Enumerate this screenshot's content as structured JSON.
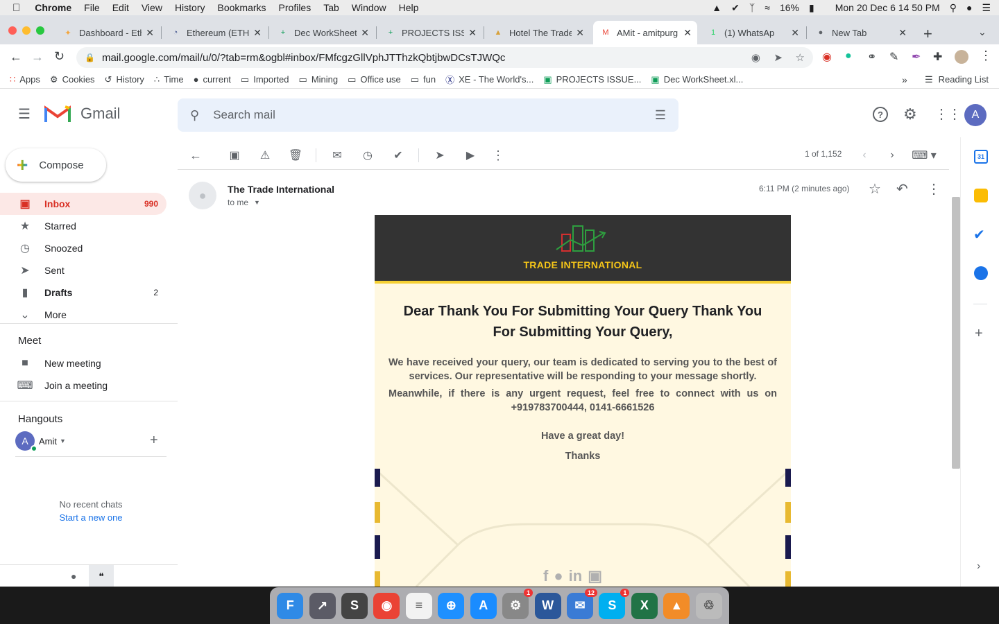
{
  "menubar": {
    "app": "Chrome",
    "items": [
      "File",
      "Edit",
      "View",
      "History",
      "Bookmarks",
      "Profiles",
      "Tab",
      "Window",
      "Help"
    ],
    "battery": "16%",
    "datetime": "Mon 20 Dec  6 14 50 PM"
  },
  "tabs": [
    {
      "title": "Dashboard - Eth",
      "fav": "✦",
      "favColor": "#f4a53a"
    },
    {
      "title": "Ethereum (ETH)",
      "fav": "◔",
      "favColor": "#3b4e8a"
    },
    {
      "title": "Dec WorkSheet",
      "fav": "+",
      "favColor": "#0f9d58"
    },
    {
      "title": "PROJECTS ISSU",
      "fav": "+",
      "favColor": "#0f9d58"
    },
    {
      "title": "Hotel The Trade",
      "fav": "▲",
      "favColor": "#d7a13b"
    },
    {
      "title": "AMit - amitpurg",
      "fav": "M",
      "favColor": "#ea4335"
    },
    {
      "title": "(1) WhatsAp",
      "fav": "1",
      "favColor": "#25d366"
    },
    {
      "title": "New Tab",
      "fav": "●",
      "favColor": "#5f6368"
    }
  ],
  "url": "mail.google.com/mail/u/0/?tab=rm&ogbl#inbox/FMfcgzGllVphJTThzkQbtjbwDCsTJWQc",
  "bookmarks": [
    {
      "label": "Apps",
      "icon": "grid-icon"
    },
    {
      "label": "Cookies",
      "icon": "gear-icon"
    },
    {
      "label": "History",
      "icon": "history-icon"
    },
    {
      "label": "Time",
      "icon": "dots-icon"
    },
    {
      "label": "current",
      "icon": "globe-icon"
    },
    {
      "label": "Imported",
      "icon": "folder-icon"
    },
    {
      "label": "Mining",
      "icon": "folder-icon"
    },
    {
      "label": "Office use",
      "icon": "folder-icon"
    },
    {
      "label": "fun",
      "icon": "folder-icon"
    },
    {
      "label": "XE - The World's...",
      "icon": "xe-icon"
    },
    {
      "label": "PROJECTS ISSUE...",
      "icon": "sheets-icon"
    },
    {
      "label": "Dec WorkSheet.xl...",
      "icon": "sheets-icon"
    }
  ],
  "reading_list": "Reading List",
  "gmail": {
    "brand": "Gmail",
    "search_placeholder": "Search mail",
    "avatar": "A",
    "compose": "Compose",
    "nav": [
      {
        "label": "Inbox",
        "count": "990",
        "icon": "inbox-icon",
        "active": true
      },
      {
        "label": "Starred",
        "count": "",
        "icon": "star-icon"
      },
      {
        "label": "Snoozed",
        "count": "",
        "icon": "clock-icon"
      },
      {
        "label": "Sent",
        "count": "",
        "icon": "send-icon"
      },
      {
        "label": "Drafts",
        "count": "2",
        "icon": "draft-icon"
      },
      {
        "label": "More",
        "count": "",
        "icon": "chevron-down-icon"
      }
    ],
    "meet_heading": "Meet",
    "meet": [
      {
        "label": "New meeting",
        "icon": "video-icon"
      },
      {
        "label": "Join a meeting",
        "icon": "keyboard-icon"
      }
    ],
    "hangouts_heading": "Hangouts",
    "hangouts_user": "Amit",
    "hangouts_avatar": "A",
    "no_chats": "No recent chats",
    "start_new": "Start a new one",
    "pager": "1 of 1,152"
  },
  "email": {
    "sender": "The Trade International",
    "to": "to me",
    "time": "6:11 PM (2 minutes ago)",
    "logo_text": "TRADE INTERNATIONAL",
    "heading": "Dear Thank You For Submitting Your Query Thank You For Submitting Your Query,",
    "para1": "We have received your query, our team is dedicated to serving you to the best of services. Our representative will be responding to your message shortly.",
    "para2": "Meanwhile, if there is any urgent request, feel free to connect with us on +919783700444, 0141-6661526",
    "greeting": "Have a great day!",
    "thanks": "Thanks"
  },
  "dock": [
    {
      "name": "finder",
      "label": "F",
      "color": "#2f8ae6",
      "badge": ""
    },
    {
      "name": "launchpad",
      "label": "↗",
      "color": "#5b5b66",
      "badge": ""
    },
    {
      "name": "sublime",
      "label": "S",
      "color": "#444",
      "badge": ""
    },
    {
      "name": "chrome",
      "label": "◉",
      "color": "#ea4335",
      "badge": ""
    },
    {
      "name": "notes",
      "label": "≡",
      "color": "#f2f2f2",
      "badge": ""
    },
    {
      "name": "safari",
      "label": "⊕",
      "color": "#1e90ff",
      "badge": ""
    },
    {
      "name": "appstore",
      "label": "A",
      "color": "#1a8cff",
      "badge": ""
    },
    {
      "name": "settings",
      "label": "⚙",
      "color": "#888",
      "badge": "1"
    },
    {
      "name": "word",
      "label": "W",
      "color": "#2b579a",
      "badge": ""
    },
    {
      "name": "thunderbird",
      "label": "✉",
      "color": "#3a7bd5",
      "badge": "12"
    },
    {
      "name": "skype",
      "label": "S",
      "color": "#00aff0",
      "badge": "1"
    },
    {
      "name": "excel",
      "label": "X",
      "color": "#217346",
      "badge": ""
    },
    {
      "name": "vlc",
      "label": "▲",
      "color": "#f28c28",
      "badge": ""
    },
    {
      "name": "trash",
      "label": "♲",
      "color": "#bbb",
      "badge": ""
    }
  ]
}
